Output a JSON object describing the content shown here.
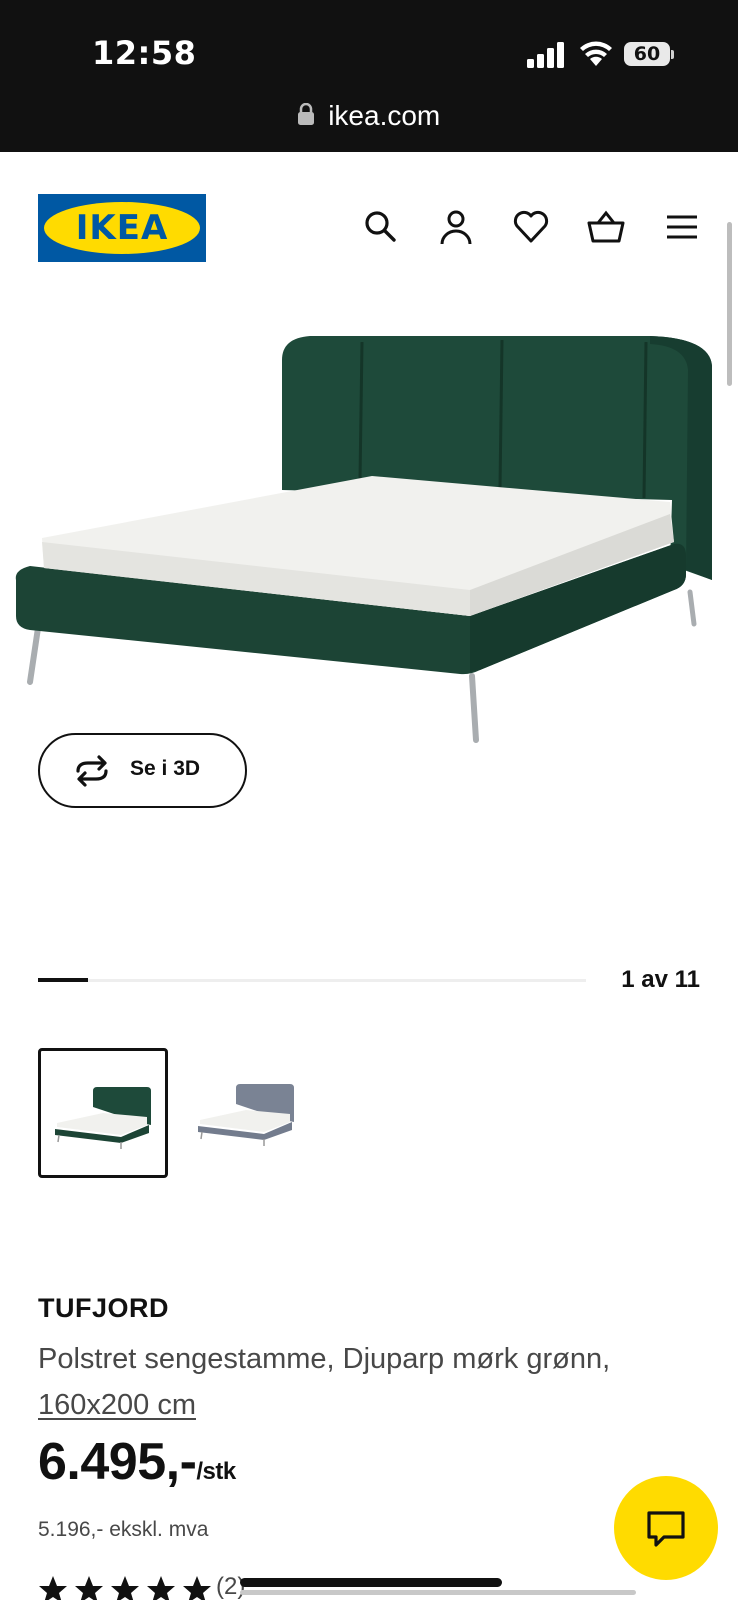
{
  "status_bar": {
    "time": "12:58",
    "battery": "60",
    "url": "ikea.com"
  },
  "header": {
    "logo_text": "IKEA",
    "brand_blue": "#0058a3",
    "brand_yellow": "#ffdb00",
    "icons": [
      "search-icon",
      "account-icon",
      "heart-icon",
      "basket-icon",
      "menu-icon"
    ]
  },
  "gallery": {
    "view_3d_label": "Se i 3D",
    "counter": "1 av 11",
    "current": 1,
    "total": 11,
    "thumbnails": [
      "dark green bed",
      "grey bed"
    ]
  },
  "product": {
    "name": "TUFJORD",
    "description": "Polstret sengestamme, Djuparp mørk grønn,",
    "size": "160x200 cm",
    "price": "6.495,-",
    "price_unit": "/stk",
    "price_ex_vat": "5.196,- ekskl. mva",
    "rating_stars": 5,
    "reviews": "(2)"
  }
}
